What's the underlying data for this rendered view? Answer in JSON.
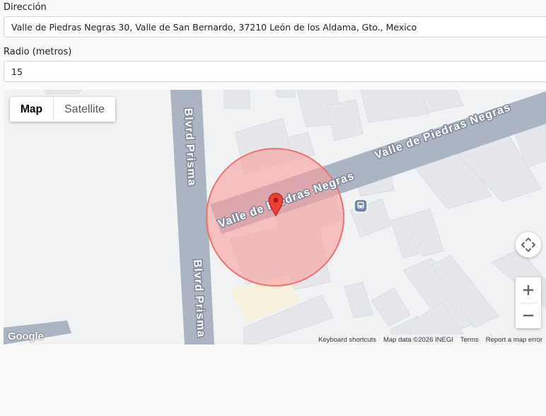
{
  "form": {
    "address_label": "Dirección",
    "address_value": "Valle de Piedras Negras 30, Valle de San Bernardo, 37210 León de los Aldama, Gto., Mexico",
    "radius_label": "Radio (metros)",
    "radius_value": "15"
  },
  "map": {
    "type_controls": {
      "map": "Map",
      "satellite": "Satellite"
    },
    "street_labels": {
      "valle_upper": "Valle de Piedras Negras",
      "valle_lower": "Valle de Piedras Negras",
      "blvd_upper": "Blvrd Prisma",
      "blvd_lower": "Blvrd Prisma"
    },
    "footer": {
      "shortcuts": "Keyboard shortcuts",
      "map_data": "Map data ©2026 INEGI",
      "terms": "Terms",
      "report": "Report a map error"
    },
    "logo": "Google",
    "colors": {
      "road": "#aab4c3",
      "building": "#e5e7ea",
      "circle_fill": "#f8a0a0",
      "circle_stroke": "#ee7070",
      "marker": "#ea4335"
    },
    "icons": [
      "bus-stop-icon",
      "map-pin-icon",
      "camera-control-icon",
      "zoom-in-icon",
      "zoom-out-icon"
    ]
  }
}
